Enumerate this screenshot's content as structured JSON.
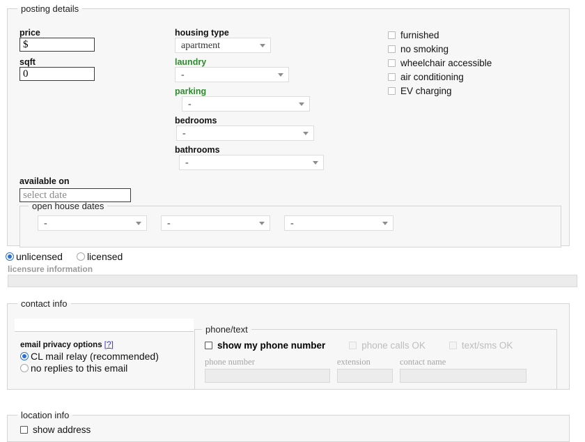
{
  "posting_details": {
    "legend": "posting details",
    "price": {
      "label": "price",
      "value": "$"
    },
    "sqft": {
      "label": "sqft",
      "value": "0"
    },
    "housing_type": {
      "label": "housing type",
      "value": "apartment"
    },
    "laundry": {
      "label": "laundry",
      "value": "-"
    },
    "parking": {
      "label": "parking",
      "value": "-"
    },
    "bedrooms": {
      "label": "bedrooms",
      "value": "-"
    },
    "bathrooms": {
      "label": "bathrooms",
      "value": "-"
    },
    "amenities": [
      {
        "label": "furnished",
        "checked": false
      },
      {
        "label": "no smoking",
        "checked": false
      },
      {
        "label": "wheelchair accessible",
        "checked": false
      },
      {
        "label": "air conditioning",
        "checked": false
      },
      {
        "label": "EV charging",
        "checked": false
      }
    ],
    "available_on": {
      "label": "available on",
      "placeholder": "select date",
      "value": ""
    },
    "open_house": {
      "legend": "open house dates",
      "slots": [
        "-",
        "-",
        "-"
      ]
    }
  },
  "licensure": {
    "options": [
      {
        "label": "unlicensed",
        "selected": true
      },
      {
        "label": "licensed",
        "selected": false
      }
    ],
    "caption": "licensure information",
    "input_value": ""
  },
  "contact_info": {
    "legend": "contact info",
    "email": {
      "value": "",
      "placeholder": ""
    },
    "privacy": {
      "title": "email privacy options",
      "help_label": "[?]",
      "options": [
        {
          "label": "CL mail relay (recommended)",
          "selected": true
        },
        {
          "label": "no replies to this email",
          "selected": false
        }
      ]
    },
    "phone_text": {
      "legend": "phone/text",
      "checkboxes": [
        {
          "label": "show my phone number",
          "checked": false,
          "disabled": false
        },
        {
          "label": "phone calls OK",
          "checked": false,
          "disabled": true
        },
        {
          "label": "text/sms OK",
          "checked": false,
          "disabled": true
        }
      ],
      "fields": [
        {
          "label": "phone number",
          "value": ""
        },
        {
          "label": "extension",
          "value": ""
        },
        {
          "label": "contact name",
          "value": ""
        }
      ]
    }
  },
  "location_info": {
    "legend": "location info",
    "show_address": {
      "label": "show address",
      "checked": false
    }
  },
  "colors": {
    "green_label": "#2f8a2f",
    "radio_accent": "#2a6fd6",
    "link": "#3b3bbf",
    "panel_bg": "#f7f7f7",
    "disabled_bg": "#ececec"
  }
}
